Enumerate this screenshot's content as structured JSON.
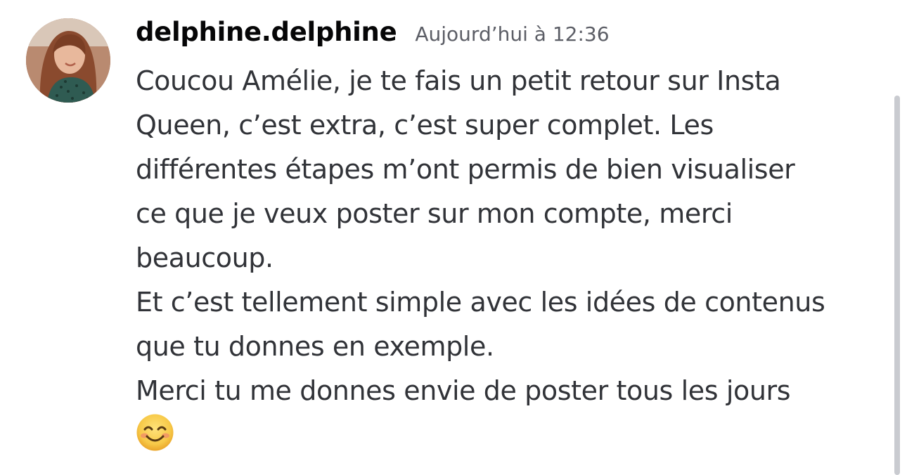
{
  "message": {
    "author": "delphine.delphine",
    "timestamp": "Aujourd’hui à 12:36",
    "lines": [
      "Coucou Amélie, je te fais un petit retour sur Insta",
      "Queen, c’est extra, c’est super complet. Les",
      "différentes étapes m’ont permis de bien visualiser",
      "ce que je veux poster sur mon compte, merci",
      "beaucoup.",
      "Et c’est tellement simple avec les idées de contenus",
      "que tu donnes en exemple.",
      "Merci tu me donnes envie de poster tous les jours"
    ],
    "emoji": "smiling-face-with-smiling-eyes-icon"
  },
  "colors": {
    "author": "#060607",
    "timestamp": "#5c5e66",
    "text": "#313338",
    "scrollbar": "#c9cbd0",
    "emoji_face": "#f7c948"
  }
}
